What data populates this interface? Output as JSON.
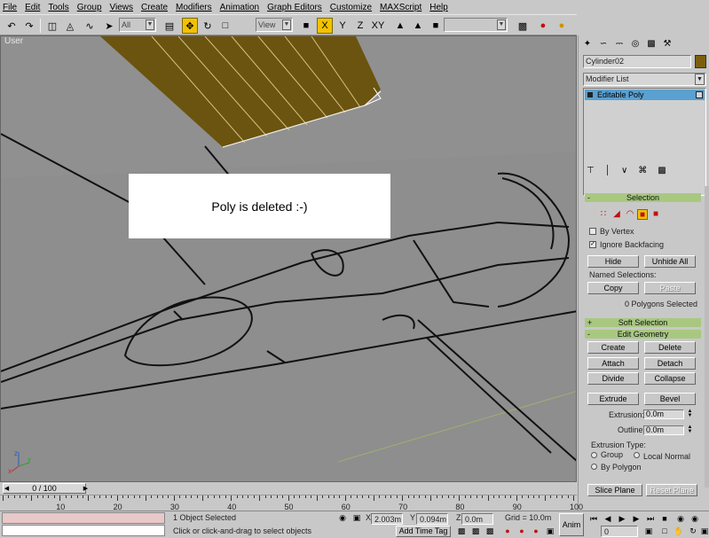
{
  "menu": [
    "File",
    "Edit",
    "Tools",
    "Group",
    "Views",
    "Create",
    "Modifiers",
    "Animation",
    "Graph Editors",
    "Customize",
    "MAXScript",
    "Help"
  ],
  "toolbar": {
    "selection_filter": "All",
    "ref_coord": "View",
    "named_selection": ""
  },
  "viewport": {
    "label": "User",
    "message": "Poly is deleted :-)",
    "background": "#8e8e8e",
    "wing_color": "#6b5410"
  },
  "command_panel": {
    "object_name": "Cylinder02",
    "object_color": "#7c5e10",
    "modifier_list": "Modifier List",
    "stack_item": "Editable Poly",
    "selection": {
      "title": "Selection",
      "by_vertex": "By Vertex",
      "ignore_backfacing": "Ignore Backfacing",
      "hide": "Hide",
      "unhide_all": "Unhide All",
      "named_selections": "Named Selections:",
      "copy": "Copy",
      "paste": "Paste",
      "status": "0 Polygons Selected"
    },
    "soft_selection": {
      "title": "Soft Selection"
    },
    "edit_geometry": {
      "title": "Edit Geometry",
      "create": "Create",
      "delete": "Delete",
      "attach": "Attach",
      "detach": "Detach",
      "divide": "Divide",
      "collapse": "Collapse",
      "extrude": "Extrude",
      "bevel": "Bevel",
      "extrusion_label": "Extrusion:",
      "extrusion_value": "0.0m",
      "outline_label": "Outline",
      "outline_value": "0.0m",
      "extrusion_type": "Extrusion Type:",
      "group": "Group",
      "local_normal": "Local Normal",
      "by_polygon": "By Polygon",
      "slice_plane": "Slice Plane",
      "reset_plane": "Reset Plane"
    }
  },
  "time": {
    "frame_display": "0 / 100",
    "ticks": [
      "10",
      "20",
      "30",
      "40",
      "50",
      "60",
      "70",
      "80",
      "90",
      "100"
    ]
  },
  "status": {
    "selected": "1 Object Selected",
    "prompt": "Click or click-and-drag to select objects",
    "x": "2.003m",
    "y": "0.094m",
    "z": "0.0m",
    "grid": "Grid = 10.0m",
    "add_time_tag": "Add Time Tag",
    "anim": "Anim",
    "frame": "0"
  }
}
